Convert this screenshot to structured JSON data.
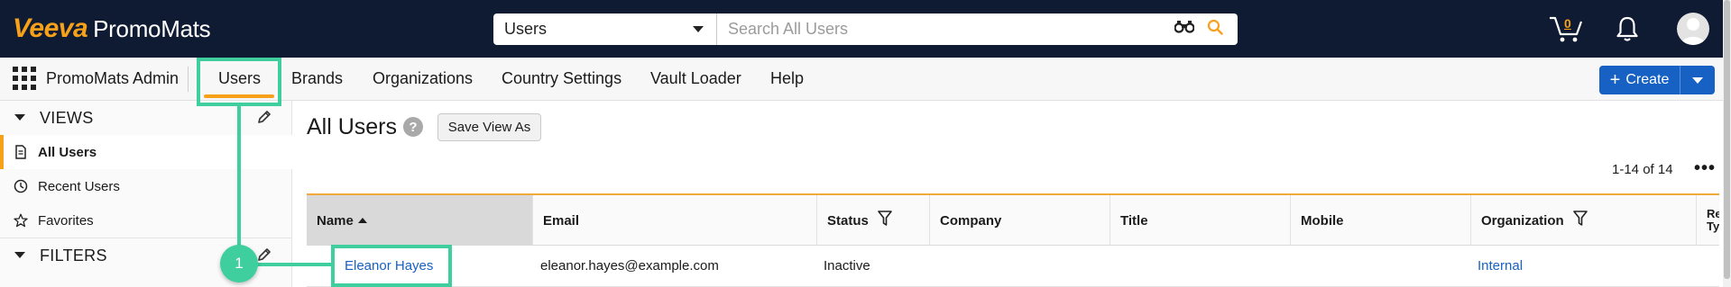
{
  "header": {
    "logo_brand": "Veeva",
    "logo_product": "PromoMats",
    "search_scope": "Users",
    "search_placeholder": "Search All Users",
    "cart_count": "0"
  },
  "nav": {
    "app_name": "PromoMats Admin",
    "tabs": [
      {
        "label": "Users"
      },
      {
        "label": "Brands"
      },
      {
        "label": "Organizations"
      },
      {
        "label": "Country Settings"
      },
      {
        "label": "Vault Loader"
      },
      {
        "label": "Help"
      }
    ],
    "create_label": "Create"
  },
  "sidebar": {
    "views_label": "VIEWS",
    "items": [
      {
        "label": "All Users",
        "icon": "document-icon"
      },
      {
        "label": "Recent Users",
        "icon": "clock-icon"
      },
      {
        "label": "Favorites",
        "icon": "star-icon"
      }
    ],
    "filters_label": "FILTERS"
  },
  "main": {
    "title": "All Users",
    "help_glyph": "?",
    "save_view_label": "Save View As",
    "count_text": "1-14 of 14",
    "more_glyph": "•••",
    "columns": [
      {
        "label": "Name"
      },
      {
        "label": "Email"
      },
      {
        "label": "Status"
      },
      {
        "label": "Company"
      },
      {
        "label": "Title"
      },
      {
        "label": "Mobile"
      },
      {
        "label": "Organization"
      },
      {
        "label": "Re Ty"
      }
    ],
    "rows": [
      {
        "name": "Eleanor Hayes",
        "email": "eleanor.hayes@example.com",
        "status": "Inactive",
        "company": "",
        "title": "",
        "mobile": "",
        "organization": "Internal"
      }
    ]
  },
  "annotation": {
    "badge": "1"
  },
  "colors": {
    "header_bg": "#0e1b33",
    "brand_orange": "#f7a11a",
    "primary_blue": "#1761c4",
    "highlight_green": "#3fcf9e"
  }
}
